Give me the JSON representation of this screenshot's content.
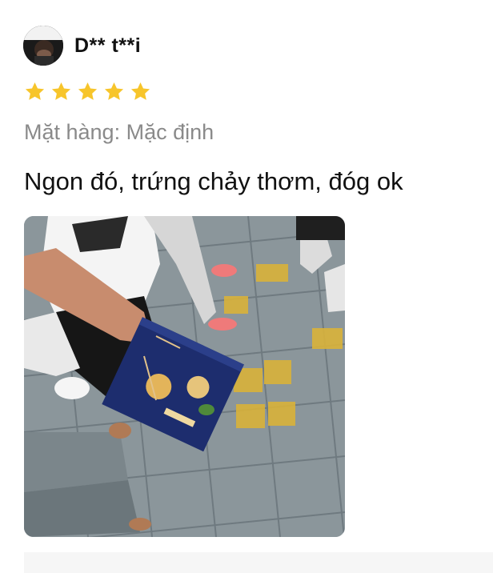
{
  "review": {
    "username": "D** t**i",
    "rating": 5,
    "rating_max": 5,
    "variant_text": "Mặt hàng: Mặc định",
    "comment": "Ngon đó, trứng chảy thơm, đóg ok"
  },
  "colors": {
    "star": "#F7C52B",
    "variant_text": "#8a8a8a",
    "footer_bg": "#f6f6f6"
  },
  "icons": {
    "star": "star-icon",
    "avatar": "user-avatar"
  }
}
